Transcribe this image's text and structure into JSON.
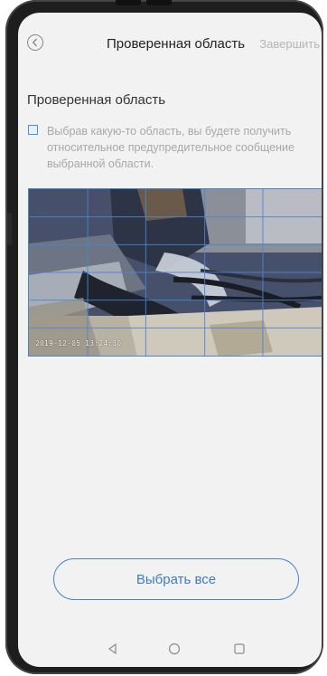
{
  "header": {
    "title": "Проверенная область",
    "done_label": "Завершить",
    "back_icon": "chevron-left-icon"
  },
  "section": {
    "title": "Проверенная область",
    "description": "Выбрав какую-то область, вы будете получить относительное предупредительное сообщение выбранной области.",
    "checkbox_checked": false
  },
  "camera": {
    "timestamp": "2019-12-05 13:24:30",
    "grid_columns": 5,
    "grid_rows": 6
  },
  "select_all": {
    "label": "Выбрать все"
  },
  "navbar": {
    "back_icon": "triangle-back-icon",
    "home_icon": "circle-home-icon",
    "recent_icon": "square-recent-icon"
  },
  "colors": {
    "accent": "#4a86d0",
    "text_primary": "#222222",
    "text_secondary": "#a8a8a8",
    "done_disabled": "#b5b5b5",
    "screen_bg": "#f2f2f2"
  }
}
